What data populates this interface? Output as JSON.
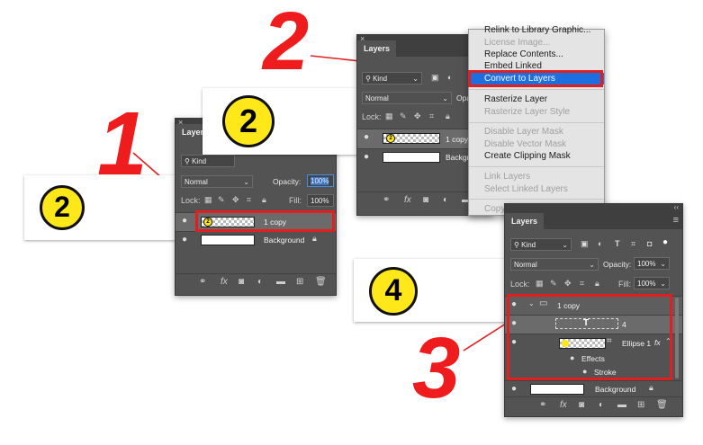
{
  "callouts": {
    "step1": "1",
    "step2": "2",
    "step3": "3",
    "badge_left": "2",
    "badge_top": "2",
    "badge_right": "4"
  },
  "colors": {
    "accent_red": "#e21f1f",
    "badge_yellow": "#ffe81a",
    "menu_highlight": "#1d6fe0"
  },
  "panel1": {
    "close": "×",
    "tab": "Layers",
    "kind": "Kind",
    "blend_mode": "Normal",
    "opacity_label": "Opacity:",
    "opacity_value": "100%",
    "lock_label": "Lock:",
    "fill_label": "Fill:",
    "fill_value": "100%",
    "layers": [
      {
        "name": "1 copy",
        "badge": "2"
      },
      {
        "name": "Background"
      }
    ],
    "bottom_icons": [
      "link-icon",
      "fx-icon",
      "mask-icon",
      "adjustment-icon",
      "folder-icon",
      "new-layer-icon",
      "trash-icon"
    ],
    "fx": "fx"
  },
  "panel2": {
    "close": "×",
    "tab": "Layers",
    "kind": "Kind",
    "blend_mode": "Normal",
    "opacity_label": "Opa",
    "lock_label": "Lock:",
    "layers": [
      {
        "name": "1 copy",
        "badge": "2"
      },
      {
        "name": "Backgr"
      }
    ],
    "fx": "fx"
  },
  "context_menu": {
    "items": [
      {
        "label": "Relink to Library Graphic...",
        "disabled": false
      },
      {
        "label": "License Image...",
        "disabled": true
      },
      {
        "label": "Replace Contents...",
        "disabled": false
      },
      {
        "label": "Embed Linked",
        "disabled": false
      },
      {
        "label": "Convert to Layers",
        "disabled": false,
        "highlighted": true
      },
      {
        "label": "Rasterize Layer",
        "disabled": false
      },
      {
        "label": "Rasterize Layer Style",
        "disabled": true
      },
      {
        "label": "Disable Layer Mask",
        "disabled": true
      },
      {
        "label": "Disable Vector Mask",
        "disabled": true
      },
      {
        "label": "Create Clipping Mask",
        "disabled": false
      },
      {
        "label": "Link Layers",
        "disabled": true
      },
      {
        "label": "Select Linked Layers",
        "disabled": true
      },
      {
        "label": "Copy Layer Style",
        "disabled": true
      }
    ]
  },
  "panel3": {
    "collapse": "‹‹",
    "tab": "Layers",
    "menu_icon": "≡",
    "kind": "Kind",
    "blend_mode": "Normal",
    "opacity_label": "Opacity:",
    "opacity_value": "100%",
    "lock_label": "Lock:",
    "fill_label": "Fill:",
    "fill_value": "100%",
    "layers": [
      {
        "name": "1 copy",
        "type": "group"
      },
      {
        "name": "4",
        "type": "text",
        "glyph": "T"
      },
      {
        "name": "Ellipse 1",
        "type": "shape",
        "fx": "fx"
      },
      {
        "name": "Effects",
        "type": "effects"
      },
      {
        "name": "Stroke",
        "type": "effect"
      },
      {
        "name": "Background",
        "type": "background"
      }
    ],
    "fx": "fx"
  }
}
